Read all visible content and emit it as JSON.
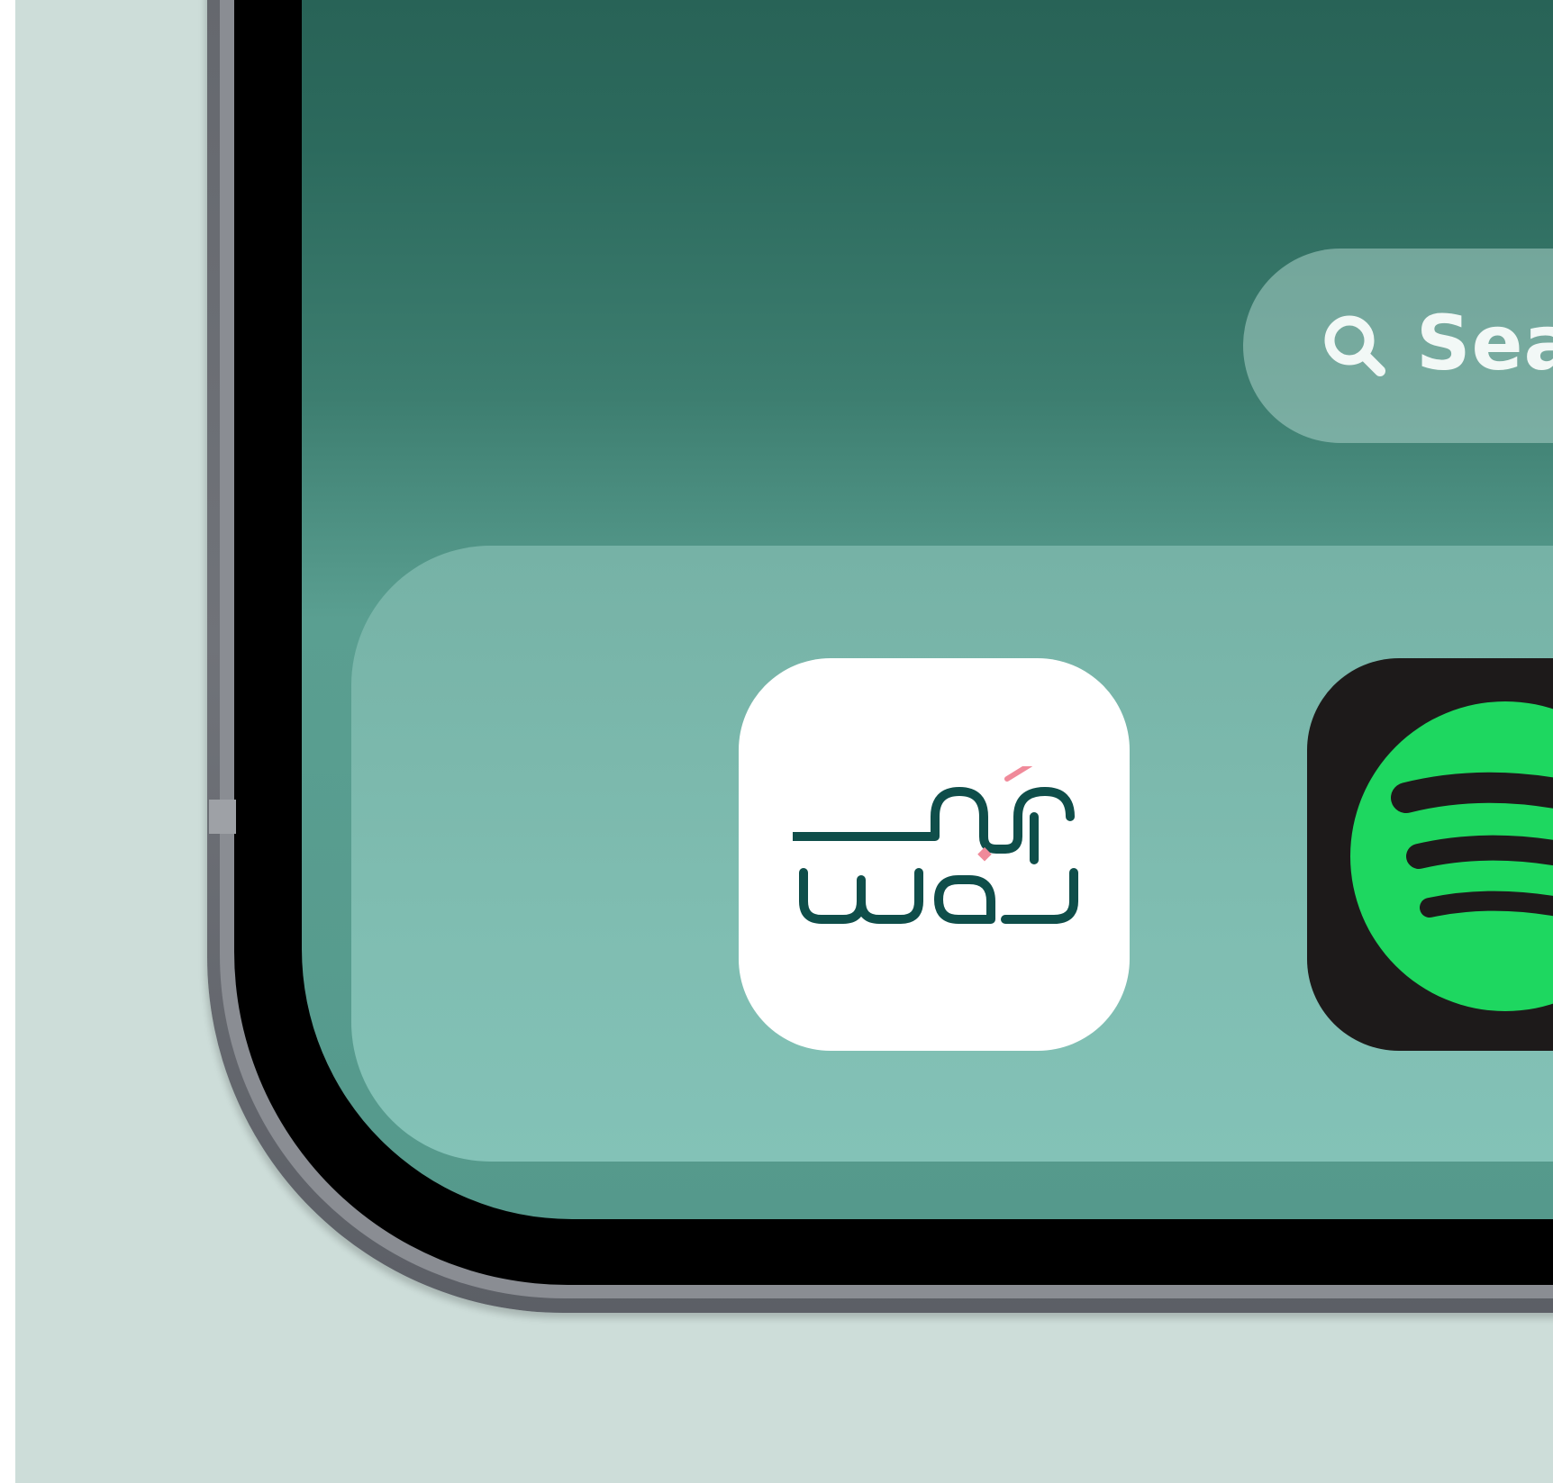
{
  "search": {
    "label": "Sea",
    "icon": "search-icon"
  },
  "dock": {
    "apps": [
      {
        "name": "wajd",
        "logo_text": "wajd",
        "icon": "wajd-logo-icon",
        "brand_color": "#0f4e4a",
        "accent_color": "#f08a9a"
      },
      {
        "name": "spotify",
        "icon": "spotify-logo-icon",
        "brand_color": "#1ed760"
      }
    ]
  },
  "colors": {
    "background": "#cdddd9",
    "screen_top": "#1f5147",
    "dock": "#7fbdb1"
  }
}
